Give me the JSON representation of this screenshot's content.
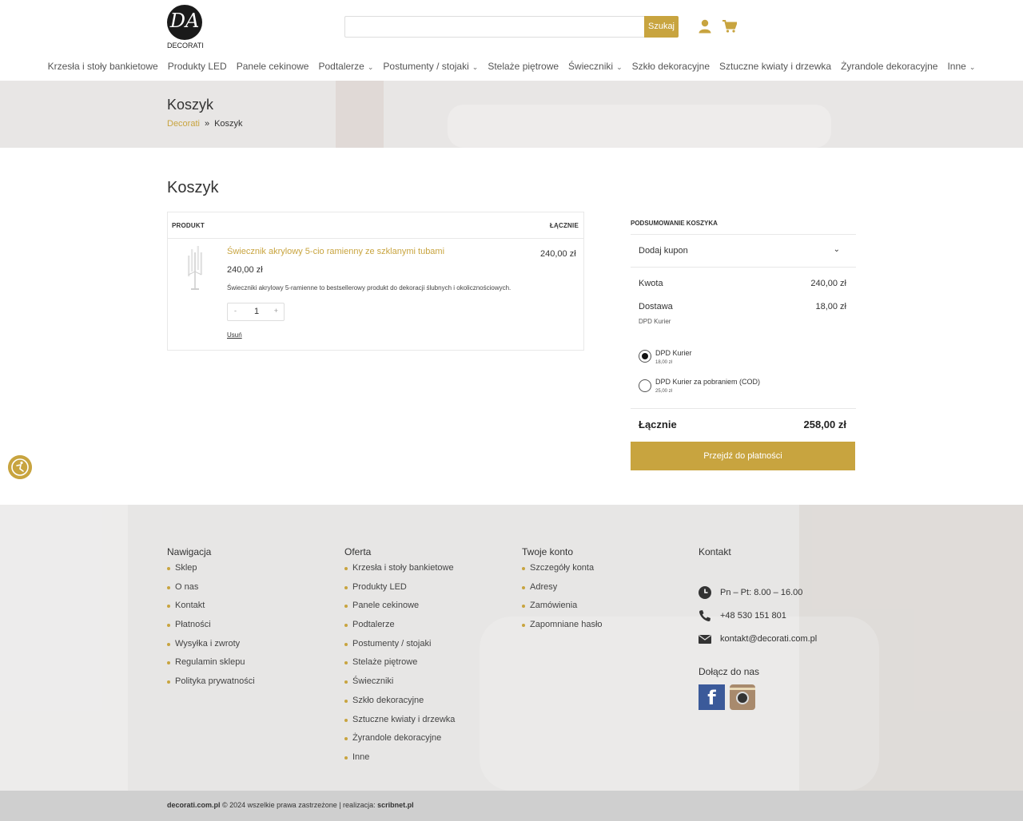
{
  "brand": {
    "logo_text": "DECORATI",
    "logo_mark": "DA"
  },
  "search": {
    "placeholder": "",
    "button_label": "Szukaj"
  },
  "nav": {
    "items": [
      {
        "label": "Krzesła i stoły bankietowe",
        "dropdown": false
      },
      {
        "label": "Produkty LED",
        "dropdown": false
      },
      {
        "label": "Panele cekinowe",
        "dropdown": false
      },
      {
        "label": "Podtalerze",
        "dropdown": true
      },
      {
        "label": "Postumenty / stojaki",
        "dropdown": true
      },
      {
        "label": "Stelaże piętrowe",
        "dropdown": false
      },
      {
        "label": "Świeczniki",
        "dropdown": true
      },
      {
        "label": "Szkło dekoracyjne",
        "dropdown": false
      },
      {
        "label": "Sztuczne kwiaty i drzewka",
        "dropdown": false
      },
      {
        "label": "Żyrandole dekoracyjne",
        "dropdown": false
      },
      {
        "label": "Inne",
        "dropdown": true
      }
    ]
  },
  "banner": {
    "title": "Koszyk",
    "breadcrumb": {
      "home": "Decorati",
      "separator": "»",
      "current": "Koszyk"
    }
  },
  "main": {
    "title": "Koszyk",
    "table": {
      "col_product": "PRODUKT",
      "col_total": "ŁĄCZNIE",
      "item": {
        "name": "Świecznik akrylowy 5-cio ramienny ze szklanymi tubami",
        "price": "240,00 zł",
        "description": "Świeczniki akrylowy 5-ramienne to bestsellerowy produkt do dekoracji ślubnych i okolicznościowych.",
        "quantity": "1",
        "minus": "-",
        "plus": "+",
        "remove": "Usuń",
        "line_total": "240,00 zł"
      }
    }
  },
  "summary": {
    "title": "PODSUMOWANIE KOSZYKA",
    "coupon": "Dodaj kupon",
    "amount_label": "Kwota",
    "amount_value": "240,00 zł",
    "shipping_label": "Dostawa",
    "shipping_value": "18,00 zł",
    "shipping_method": "DPD Kurier",
    "options": [
      {
        "label": "DPD Kurier",
        "price": "18,00 zł",
        "selected": true
      },
      {
        "label": "DPD Kurier za pobraniem (COD)",
        "price": "25,00 zł",
        "selected": false
      }
    ],
    "total_label": "Łącznie",
    "total_value": "258,00 zł",
    "checkout": "Przejdź do płatności"
  },
  "footer": {
    "nav": {
      "title": "Nawigacja",
      "items": [
        "Sklep",
        "O nas",
        "Kontakt",
        "Płatności",
        "Wysyłka i zwroty",
        "Regulamin sklepu",
        "Polityka prywatności"
      ]
    },
    "offer": {
      "title": "Oferta",
      "items": [
        "Krzesła i stoły bankietowe",
        "Produkty LED",
        "Panele cekinowe",
        "Podtalerze",
        "Postumenty / stojaki",
        "Stelaże piętrowe",
        "Świeczniki",
        "Szkło dekoracyjne",
        "Sztuczne kwiaty i drzewka",
        "Żyrandole dekoracyjne",
        "Inne"
      ]
    },
    "account": {
      "title": "Twoje konto",
      "items": [
        "Szczegóły konta",
        "Adresy",
        "Zamówienia",
        "Zapomniane hasło"
      ]
    },
    "contact": {
      "title": "Kontakt",
      "hours": "Pn – Pt: 8.00 – 16.00",
      "phone": "+48 530 151 801",
      "email": "kontakt@decorati.com.pl",
      "join": "Dołącz do nas",
      "facebook": "f"
    },
    "bottom": {
      "site": "decorati.com.pl",
      "copy": " © 2024 wszelkie prawa zastrzeżone | realizacja: ",
      "author": "scribnet.pl"
    }
  },
  "colors": {
    "accent": "#c8a43f",
    "text": "#333333",
    "banner_bg": "#e8e6e5",
    "bottom_bar": "#cfcfcf"
  },
  "icons": {
    "user": "user-icon",
    "cart": "cart-icon",
    "clock": "clock-icon",
    "phone": "phone-icon",
    "mail": "mail-icon",
    "accessibility": "accessibility-icon"
  }
}
